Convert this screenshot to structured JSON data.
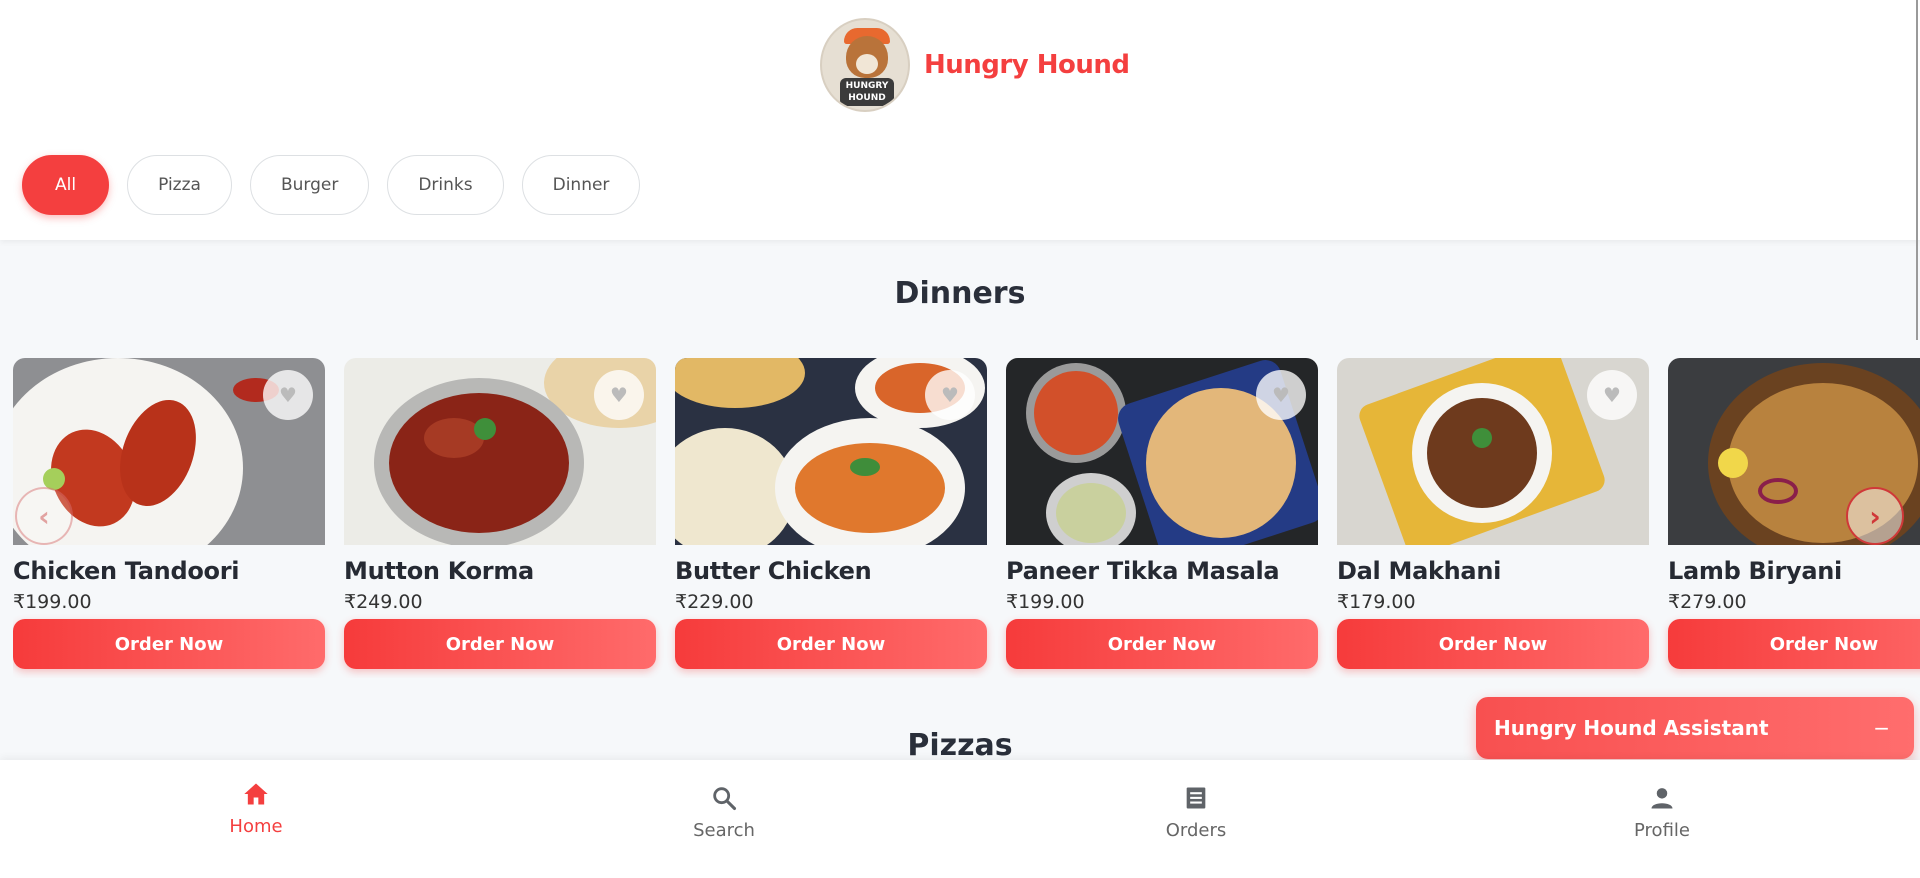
{
  "brand": {
    "name": "Hungry Hound",
    "logo_text_top": "HUNGRY",
    "logo_text_bottom": "HOUND"
  },
  "categories": [
    {
      "label": "All",
      "active": true
    },
    {
      "label": "Pizza",
      "active": false
    },
    {
      "label": "Burger",
      "active": false
    },
    {
      "label": "Drinks",
      "active": false
    },
    {
      "label": "Dinner",
      "active": false
    }
  ],
  "sections": {
    "dinners": {
      "title": "Dinners",
      "items": [
        {
          "name": "Chicken Tandoori",
          "price": "₹199.00",
          "cta": "Order Now"
        },
        {
          "name": "Mutton Korma",
          "price": "₹249.00",
          "cta": "Order Now"
        },
        {
          "name": "Butter Chicken",
          "price": "₹229.00",
          "cta": "Order Now"
        },
        {
          "name": "Paneer Tikka Masala",
          "price": "₹199.00",
          "cta": "Order Now"
        },
        {
          "name": "Dal Makhani",
          "price": "₹179.00",
          "cta": "Order Now"
        },
        {
          "name": "Lamb Biryani",
          "price": "₹279.00",
          "cta": "Order Now"
        }
      ]
    },
    "pizzas": {
      "title": "Pizzas"
    }
  },
  "carousel": {
    "prev_icon": "‹",
    "next_icon": "›"
  },
  "assistant": {
    "title": "Hungry Hound Assistant",
    "minimize": "−"
  },
  "nav": {
    "home": "Home",
    "search": "Search",
    "orders": "Orders",
    "profile": "Profile"
  },
  "colors": {
    "accent": "#f43f3f"
  }
}
